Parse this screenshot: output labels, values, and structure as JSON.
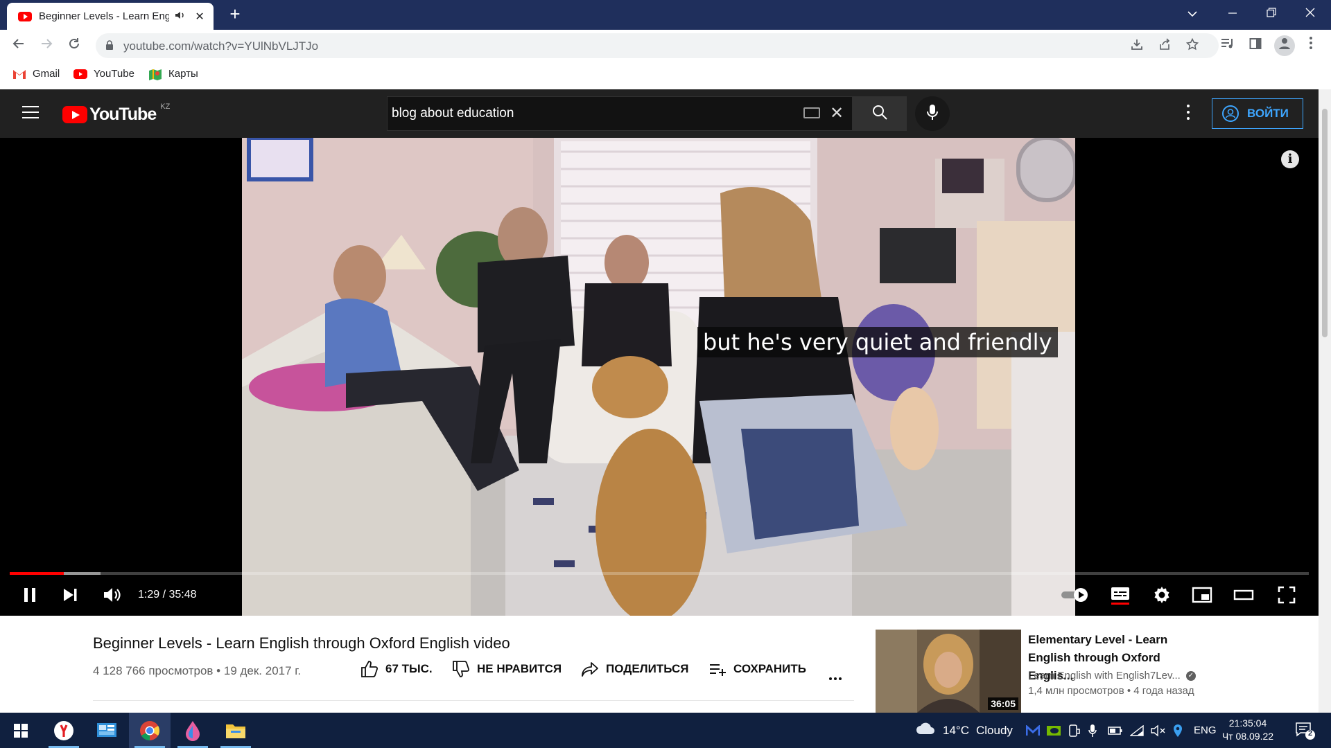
{
  "browser": {
    "tab_title": "Beginner Levels - Learn Engli",
    "new_tab_symbol": "+",
    "url": "youtube.com/watch?v=YUlNbVLJTJo",
    "bookmarks": [
      {
        "label": "Gmail",
        "icon": "gmail-icon"
      },
      {
        "label": "YouTube",
        "icon": "youtube-icon"
      },
      {
        "label": "Карты",
        "icon": "maps-icon"
      }
    ]
  },
  "youtube": {
    "region": "KZ",
    "logo_text": "YouTube",
    "search_query": "blog about education",
    "signin_label": "ВОЙТИ"
  },
  "player": {
    "caption": "but he's very quiet and friendly",
    "current_time": "1:29",
    "duration": "35:48",
    "time_display": "1:29 / 35:48",
    "played_fraction": 0.0414,
    "buffered_fraction": 0.07,
    "state": "playing",
    "autoplay": "on",
    "subtitles": "on"
  },
  "video": {
    "title": "Beginner Levels - Learn English through Oxford English video",
    "meta": "4 128 766 просмотров • 19 дек. 2017 г.",
    "like_label": "67 ТЫС.",
    "dislike_label": "НЕ НРАВИТСЯ",
    "share_label": "ПОДЕЛИТЬСЯ",
    "save_label": "СОХРАНИТЬ"
  },
  "recommended": [
    {
      "title": "Elementary Level - Learn English through Oxford Englis...",
      "channel": "Learn English with English7Lev...",
      "meta": "1,4 млн просмотров • 4 года назад",
      "duration": "36:05"
    }
  ],
  "taskbar": {
    "weather_temp": "14°C",
    "weather_desc": "Cloudy",
    "lang": "ENG",
    "time": "21:35:04",
    "date": "Чт 08.09.22",
    "notification_count": "2"
  },
  "colors": {
    "youtube_red": "#ff0000",
    "chrome_titlebar": "#1f2f5c",
    "signin_blue": "#3ea6ff",
    "taskbar": "#10203f"
  }
}
